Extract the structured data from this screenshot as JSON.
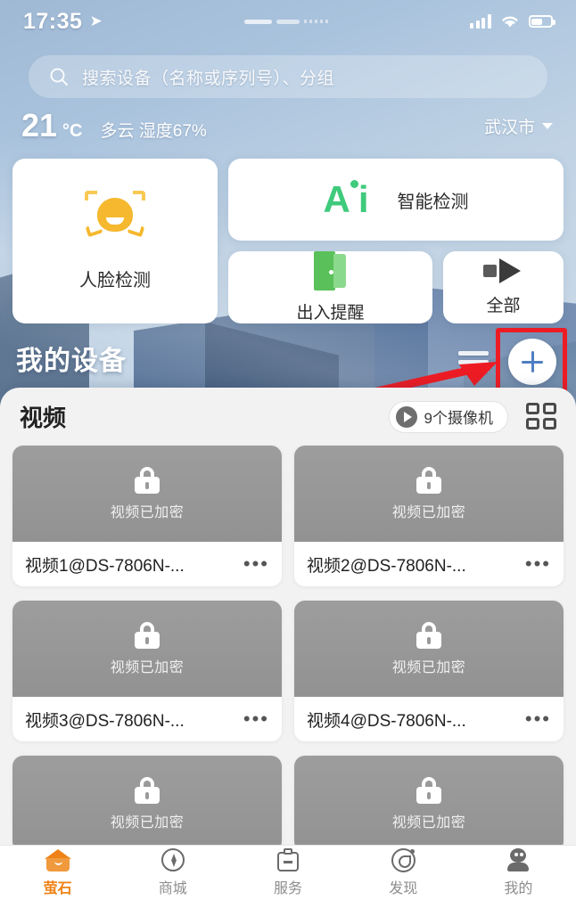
{
  "status_bar": {
    "time": "17:35",
    "location_icon": "location-arrow-icon",
    "signal_icon": "cellular-signal-icon",
    "wifi_icon": "wifi-icon",
    "battery_icon": "battery-icon"
  },
  "search": {
    "placeholder": "搜索设备（名称或序列号）、分组",
    "icon": "search-icon"
  },
  "weather": {
    "temperature": "21",
    "unit": "°C",
    "description": "多云 湿度67%",
    "city": "武汉市",
    "caret_icon": "chevron-down-icon"
  },
  "features": [
    {
      "label": "人脸检测",
      "icon": "face-detection-icon"
    },
    {
      "label": "智能检测",
      "icon": "ai-icon"
    },
    {
      "label": "出入提醒",
      "icon": "door-icon"
    },
    {
      "label": "全部",
      "icon": "all-arrow-icon"
    }
  ],
  "devices_header": {
    "title": "我的设备",
    "menu_icon": "hamburger-menu-icon",
    "add_icon": "plus-icon"
  },
  "sheet": {
    "title": "视频",
    "camera_count_label": "9个摄像机",
    "play_icon": "play-circle-icon",
    "grid_icon": "grid-view-icon",
    "encrypted_label": "视频已加密",
    "lock_icon": "lock-icon",
    "more_icon": "more-dots-icon",
    "cards": [
      {
        "name": "视频1@DS-7806N-..."
      },
      {
        "name": "视频2@DS-7806N-..."
      },
      {
        "name": "视频3@DS-7806N-..."
      },
      {
        "name": "视频4@DS-7806N-..."
      },
      {
        "name": ""
      },
      {
        "name": ""
      }
    ]
  },
  "tabs": [
    {
      "label": "萤石",
      "icon": "home-icon",
      "active": true
    },
    {
      "label": "商城",
      "icon": "bolt-icon",
      "active": false
    },
    {
      "label": "服务",
      "icon": "clipboard-icon",
      "active": false
    },
    {
      "label": "发现",
      "icon": "discover-eye-icon",
      "active": false
    },
    {
      "label": "我的",
      "icon": "user-icon",
      "active": false
    }
  ],
  "annotation": {
    "highlight_color": "#ed1c24",
    "target": "add-device-plus-button"
  }
}
